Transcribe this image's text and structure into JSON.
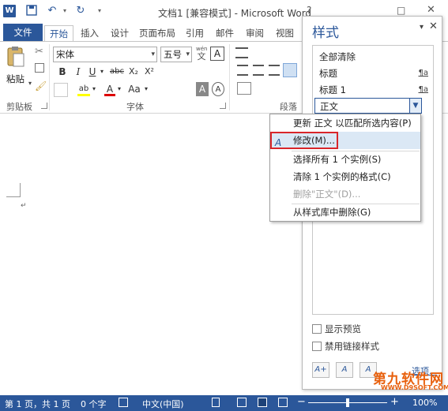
{
  "titlebar": {
    "title": "文档1 [兼容模式] - Microsoft Word",
    "app_icon_letter": "W",
    "help": "?",
    "restore": "□",
    "close": "✕"
  },
  "ribbon": {
    "tabs": [
      "文件",
      "开始",
      "插入",
      "设计",
      "页面布局",
      "引用",
      "邮件",
      "审阅",
      "视图"
    ],
    "clipboard": {
      "paste_label": "粘贴",
      "group_label": "剪贴板"
    },
    "font": {
      "font_name": "宋体",
      "font_size": "五号",
      "wen_label": "wén",
      "wen_char": "文",
      "border_char": "A",
      "buttons_row2": [
        "B",
        "I",
        "U",
        "abc",
        "X₂",
        "X²"
      ],
      "buttons_row3": [
        "ab",
        "A",
        "Aa",
        "A",
        "A"
      ],
      "group_label": "字体"
    },
    "paragraph": {
      "group_label": "段落"
    }
  },
  "document": {
    "para_mark": "↵"
  },
  "statusbar": {
    "page": "第 1 页，共 1 页",
    "words": "0 个字",
    "lang": "中文(中国)",
    "minus": "−",
    "plus": "+",
    "zoom": "100%"
  },
  "styles_pane": {
    "title": "样式",
    "items": [
      {
        "label": "全部清除",
        "mark": ""
      },
      {
        "label": "标题",
        "mark": "¶a"
      },
      {
        "label": "标题 1",
        "mark": "¶a"
      }
    ],
    "current_style": "正文",
    "checkboxes": [
      {
        "label": "显示预览",
        "checked": false
      },
      {
        "label": "禁用链接样式",
        "checked": false
      }
    ],
    "options_link": "选项..."
  },
  "context_menu": {
    "items": [
      {
        "label": "更新 正文 以匹配所选内容(P)",
        "disabled": false
      },
      {
        "label": "修改(M)...",
        "disabled": false,
        "highlighted": true
      },
      {
        "label": "选择所有 1 个实例(S)",
        "disabled": false
      },
      {
        "label": "清除 1 个实例的格式(C)",
        "disabled": false
      },
      {
        "label": "删除\"正文\"(D)...",
        "disabled": true
      },
      {
        "label": "从样式库中删除(G)",
        "disabled": false
      }
    ]
  },
  "watermark": {
    "title": "第九软件网",
    "url": "WWW.D9SOFT.COM"
  },
  "colors": {
    "accent": "#2b579a",
    "highlight_border": "#d9262a",
    "watermark": "#e8600d"
  }
}
